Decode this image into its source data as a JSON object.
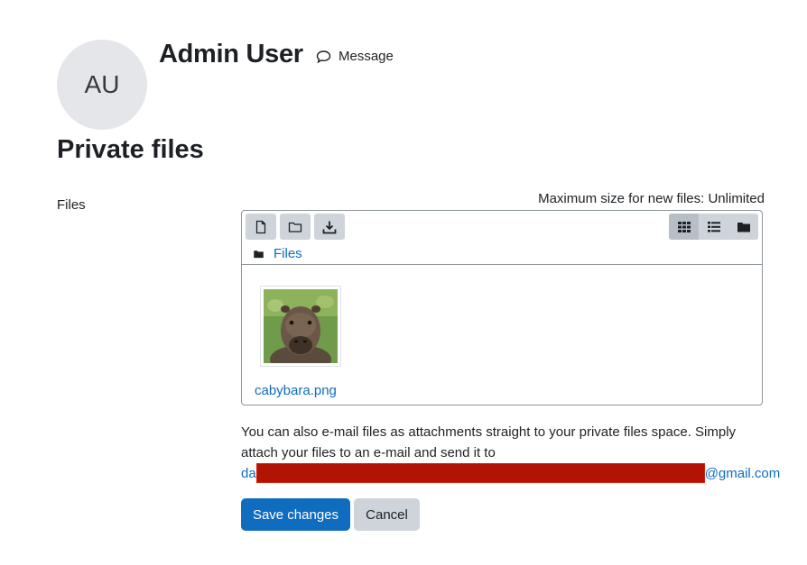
{
  "user": {
    "initials": "AU",
    "name": "Admin User",
    "message_label": "Message"
  },
  "page": {
    "title": "Private files"
  },
  "form": {
    "files_label": "Files",
    "max_size_text": "Maximum size for new files: Unlimited"
  },
  "filemanager": {
    "toolbar": [
      {
        "name": "add-file",
        "icon": "file-icon"
      },
      {
        "name": "create-folder",
        "icon": "folder-icon"
      },
      {
        "name": "download",
        "icon": "download-icon"
      }
    ],
    "views": [
      {
        "name": "icons-view",
        "icon": "grid-icon",
        "active": true
      },
      {
        "name": "list-view",
        "icon": "list-icon",
        "active": false
      },
      {
        "name": "tree-view",
        "icon": "folder-solid-icon",
        "active": false
      }
    ],
    "path_label": "Files",
    "files": [
      {
        "name": "cabybara.png"
      }
    ]
  },
  "email_info": {
    "text": "You can also e-mail files as attachments straight to your private files space. Simply attach your files to an e-mail and send it to",
    "email_prefix": "da",
    "email_suffix": "@gmail.com"
  },
  "buttons": {
    "save": "Save changes",
    "cancel": "Cancel"
  },
  "colors": {
    "primary": "#0f6cbf",
    "secondary": "#ced4da",
    "redaction": "#b11305"
  }
}
